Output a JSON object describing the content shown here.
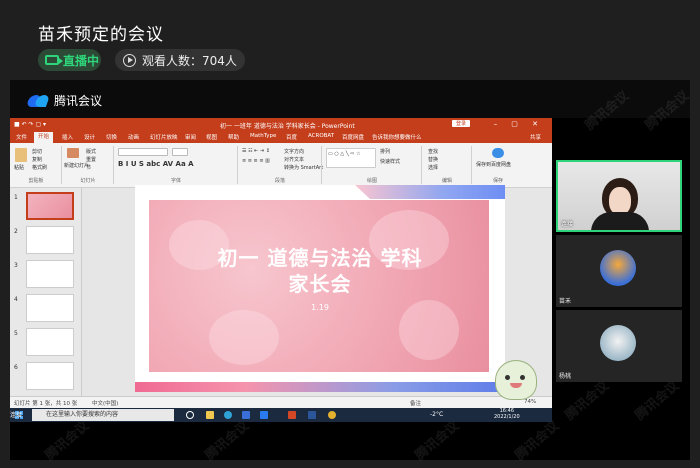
{
  "header": {
    "title": "苗禾预定的会议",
    "live_label": "直播中",
    "viewers_label": "观看人数：704人"
  },
  "meeting_app": {
    "brand": "腾讯会议",
    "watermark": "腾讯会议"
  },
  "powerpoint": {
    "window_title": "初一 一班年 道德与法治 学科家长会 - PowerPoint",
    "login_label": "登录",
    "file_tab": "文件",
    "tabs": [
      "开始",
      "插入",
      "设计",
      "切换",
      "动画",
      "幻灯片放映",
      "审阅",
      "视图",
      "帮助",
      "MathType",
      "百度",
      "ACROBAT",
      "百度网盘",
      "告诉我你想要做什么"
    ],
    "share_label": "共享",
    "ribbon_groups": [
      "剪贴板",
      "幻灯片",
      "字体",
      "段落",
      "绘图",
      "编辑",
      "保存"
    ],
    "ribbon_items": {
      "paste": "粘贴",
      "cut": "剪切",
      "copy": "复制",
      "format_painter": "格式刷",
      "new_slide": "新建幻灯片",
      "layout": "版式",
      "reset": "重置",
      "section": "节",
      "text_direction": "文字方向",
      "align_text": "对齐文本",
      "smartart": "转换为 SmartArt",
      "shapes": "形状",
      "arrange": "排列",
      "quick_styles": "快速样式",
      "find": "查找",
      "replace": "替换",
      "select": "选择",
      "save_to_baidu": "保存到百度网盘"
    },
    "slides_count": [
      "1",
      "2",
      "3",
      "4",
      "5",
      "6"
    ],
    "slide": {
      "title_line1": "初一 道德与法治 学科",
      "title_line2": "家长会",
      "date": "1.19"
    },
    "status_bar": {
      "slide_info": "幻灯片 第 1 张，共 10 张",
      "language": "中文(中国)",
      "notes": "备注",
      "zoom": "74%"
    }
  },
  "taskbar": {
    "search_placeholder": "在这里输入你要搜索的内容",
    "temperature": "-2°C",
    "time": "16:46",
    "date": "2022/1/20",
    "corner_label": "连接"
  },
  "participants": [
    {
      "name": "连接"
    },
    {
      "name": "苗禾"
    },
    {
      "name": "杨桃"
    }
  ],
  "colors": {
    "live_green": "#2fd47a",
    "ppt_red": "#c43e1c",
    "slide_pink": "#f1a7b4"
  }
}
